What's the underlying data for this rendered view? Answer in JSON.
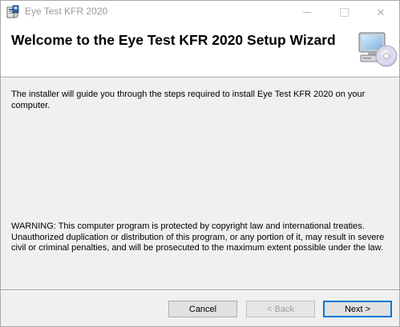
{
  "window": {
    "title": "Eye Test KFR 2020",
    "icon": "installer-icon",
    "controls": {
      "minimize": "minimize-icon",
      "maximize": "maximize-icon",
      "close_label": "✕"
    }
  },
  "banner": {
    "title": "Welcome to the Eye Test KFR 2020 Setup Wizard",
    "image": "computer-cd-icon"
  },
  "body": {
    "intro_text": "The installer will guide you through the steps required to install Eye Test KFR 2020 on your computer.",
    "warning_text": "WARNING: This computer program is protected by copyright law and international treaties. Unauthorized duplication or distribution of this program, or any portion of it, may result in severe civil or criminal penalties, and will be prosecuted to the maximum extent possible under the law."
  },
  "buttons": {
    "cancel": "Cancel",
    "back": "< Back",
    "next": "Next >"
  },
  "colors": {
    "accent": "#0078d7",
    "dialog_bg": "#f0f0f0",
    "title_text": "#999999"
  }
}
